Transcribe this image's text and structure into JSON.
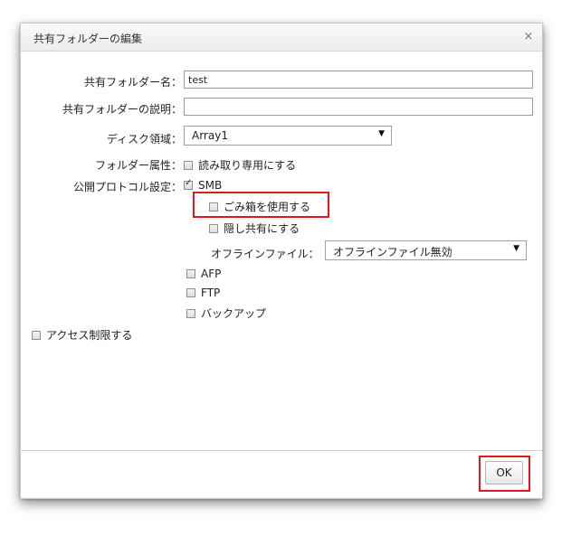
{
  "dialog": {
    "title": "共有フォルダーの編集",
    "close_glyph": "×"
  },
  "form": {
    "name_label": "共有フォルダー名：",
    "name_value": "test",
    "desc_label": "共有フォルダーの説明：",
    "desc_value": "",
    "disk_label": "ディスク領域：",
    "disk_value": "Array1",
    "attr_label": "フォルダー属性：",
    "readonly_label": "読み取り専用にする",
    "readonly_checked": false,
    "protocol_label": "公開プロトコル設定：",
    "smb_label": "SMB",
    "smb_checked": true,
    "trash_label": "ごみ箱を使用する",
    "trash_checked": false,
    "hidden_label": "隠し共有にする",
    "hidden_checked": false,
    "offline_label": "オフラインファイル：",
    "offline_value": "オフラインファイル無効",
    "afp_label": "AFP",
    "afp_checked": false,
    "ftp_label": "FTP",
    "ftp_checked": false,
    "backup_label": "バックアップ",
    "backup_checked": false,
    "access_label": "アクセス制限する",
    "access_checked": false
  },
  "footer": {
    "ok_label": "OK"
  },
  "colors": {
    "highlight": "#e0171c"
  }
}
